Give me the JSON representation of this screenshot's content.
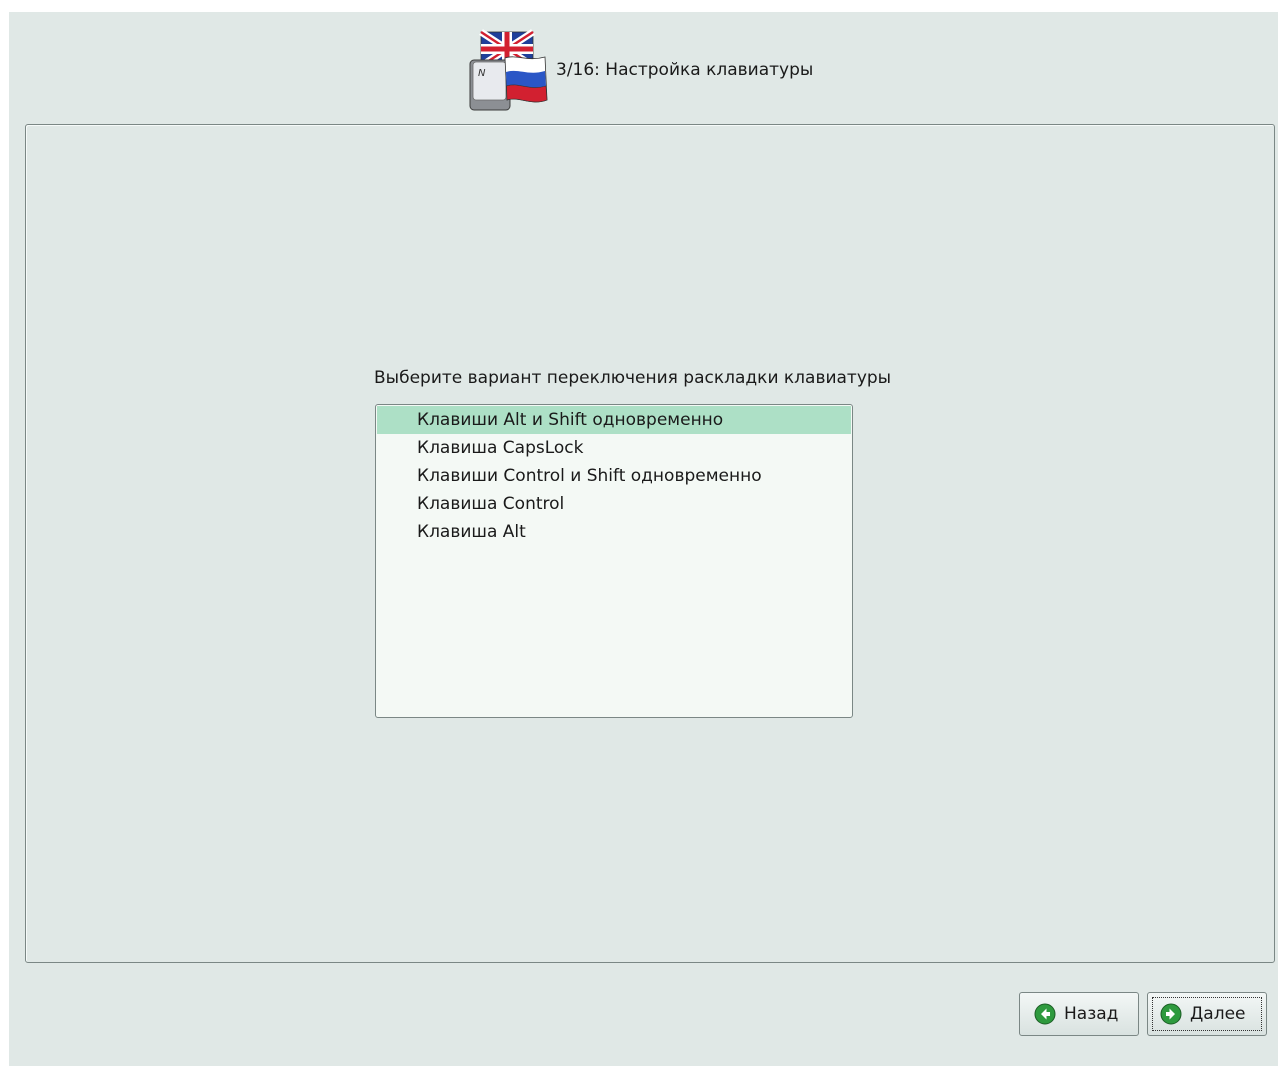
{
  "header": {
    "title": "3/16: Настройка клавиатуры",
    "icon": "keyboard-flags-icon"
  },
  "main": {
    "prompt": "Выберите вариант переключения раскладки клавиатуры",
    "options": [
      {
        "label": "Клавиши Alt и Shift одновременно",
        "selected": true
      },
      {
        "label": "Клавиша CapsLock",
        "selected": false
      },
      {
        "label": "Клавиши Control и Shift одновременно",
        "selected": false
      },
      {
        "label": "Клавиша Control",
        "selected": false
      },
      {
        "label": "Клавиша Alt",
        "selected": false
      }
    ]
  },
  "footer": {
    "back_label": "Назад",
    "next_label": "Далее",
    "back_icon": "arrow-left-circle-icon",
    "next_icon": "arrow-right-circle-icon"
  },
  "colors": {
    "background": "#e0e8e6",
    "list_background": "#f4f9f5",
    "selection": "#ade0c6",
    "nav_icon_green": "#2e9a3e"
  }
}
